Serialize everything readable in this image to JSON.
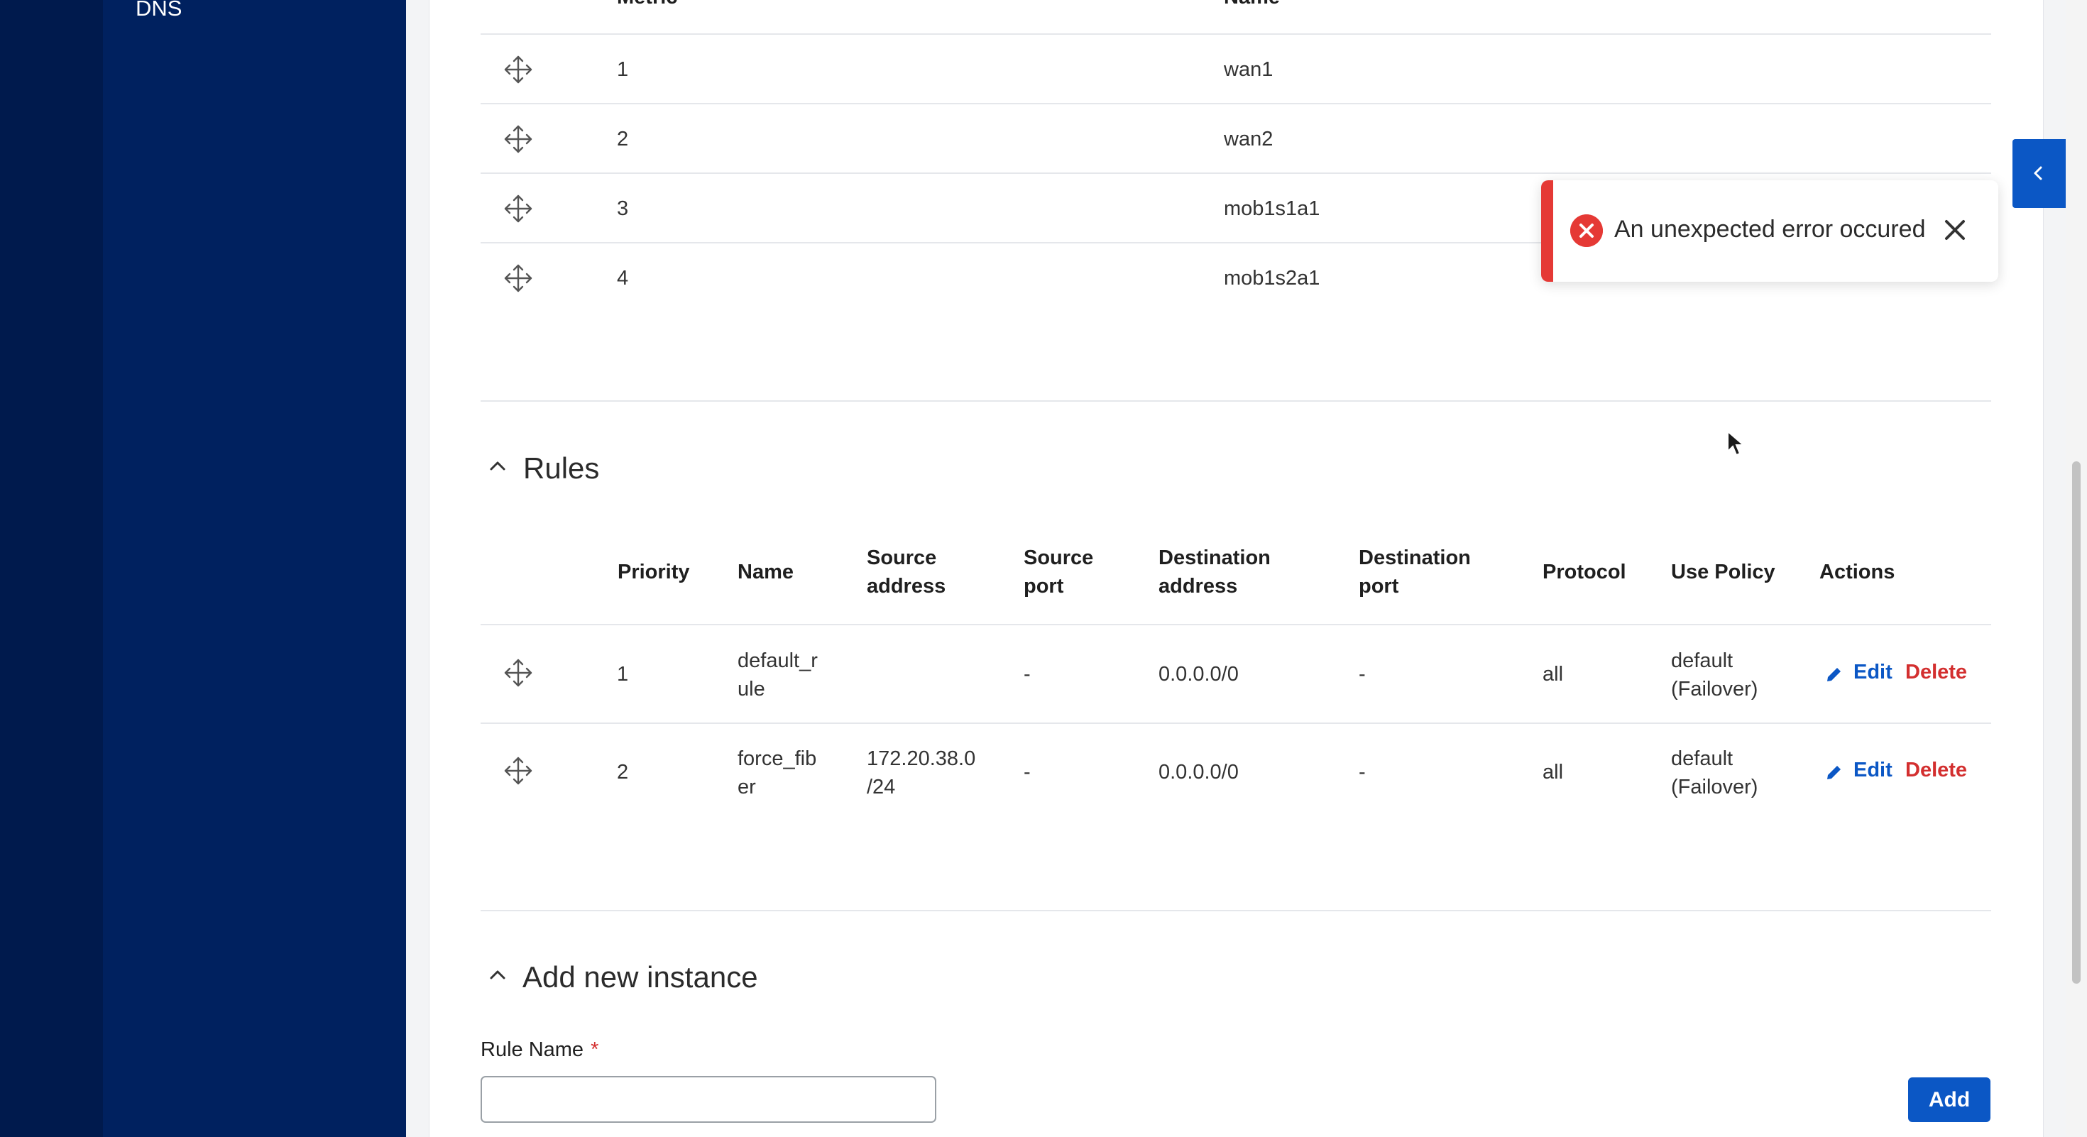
{
  "sidebar": {
    "dns_label": "DNS"
  },
  "interfaces_table": {
    "header_metric": "Metric",
    "header_name": "Name",
    "rows": [
      {
        "metric": "1",
        "name": "wan1"
      },
      {
        "metric": "2",
        "name": "wan2"
      },
      {
        "metric": "3",
        "name": "mob1s1a1"
      },
      {
        "metric": "4",
        "name": "mob1s2a1"
      }
    ]
  },
  "rules": {
    "title": "Rules",
    "headers": {
      "priority": "Priority",
      "name": "Name",
      "source_address_1": "Source",
      "source_address_2": "address",
      "source_port_1": "Source",
      "source_port_2": "port",
      "destination_address_1": "Destination",
      "destination_address_2": "address",
      "destination_port_1": "Destination",
      "destination_port_2": "port",
      "protocol": "Protocol",
      "use_policy": "Use Policy",
      "actions": "Actions"
    },
    "rows": [
      {
        "priority": "1",
        "name_1": "default_r",
        "name_2": "ule",
        "source_address_1": "",
        "source_address_2": "",
        "source_port": "-",
        "destination_address": "0.0.0.0/0",
        "destination_port": "-",
        "protocol": "all",
        "use_policy_1": "default",
        "use_policy_2": "(Failover)",
        "edit": "Edit",
        "delete": "Delete"
      },
      {
        "priority": "2",
        "name_1": "force_fib",
        "name_2": "er",
        "source_address_1": "172.20.38.0",
        "source_address_2": "/24",
        "source_port": "-",
        "destination_address": "0.0.0.0/0",
        "destination_port": "-",
        "protocol": "all",
        "use_policy_1": "default",
        "use_policy_2": "(Failover)",
        "edit": "Edit",
        "delete": "Delete"
      }
    ]
  },
  "add_instance": {
    "title": "Add new instance",
    "rule_name_label": "Rule Name",
    "required_mark": "*",
    "rule_name_value": "",
    "add_button": "Add"
  },
  "toast": {
    "message": "An unexpected error occured"
  },
  "colors": {
    "primary": "#0b57c5",
    "danger": "#d32f2f",
    "sidebar": "#00215f",
    "sidebar_rail": "#001a4d"
  }
}
